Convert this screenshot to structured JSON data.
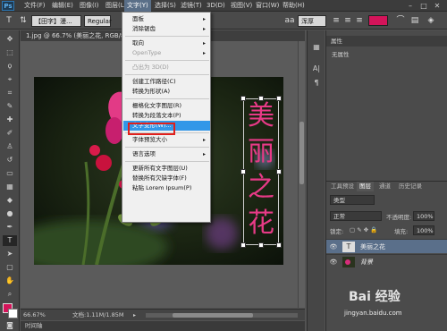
{
  "app": {
    "logo": "Ps"
  },
  "menubar": {
    "items": [
      "文件(F)",
      "编辑(E)",
      "图像(I)",
      "图层(L)",
      "文字(Y)",
      "选择(S)",
      "滤镜(T)",
      "3D(D)",
      "视图(V)",
      "窗口(W)",
      "帮助(H)"
    ],
    "active_index": 4,
    "window_buttons": [
      "–",
      "□",
      "✕"
    ]
  },
  "options": {
    "tool_icon": "T",
    "font_family": "【田字】漫...",
    "font_style": "Regular",
    "aa_mode": "浑厚",
    "text_color": "#d4145a"
  },
  "document": {
    "tab_label": "1.jpg @ 66.7% (美丽之花, RGB/8) *",
    "close": "✕",
    "zoom": "66.67%",
    "doc_size": "文档:1.11M/1.85M",
    "timeline": "时间轴",
    "canvas_text": [
      "美",
      "丽",
      "之",
      "花"
    ],
    "canvas_text_color": "#e83a87"
  },
  "dropdown": {
    "items": [
      {
        "label": "面板",
        "arrow": true,
        "disabled": false
      },
      {
        "label": "消除锯齿",
        "arrow": true,
        "disabled": false
      },
      {
        "sep": true
      },
      {
        "label": "取向",
        "arrow": true,
        "disabled": false
      },
      {
        "label": "OpenType",
        "arrow": true,
        "disabled": true
      },
      {
        "sep": true
      },
      {
        "label": "凸出为 3D(D)",
        "disabled": true
      },
      {
        "sep": true
      },
      {
        "label": "创建工作路径(C)",
        "disabled": false
      },
      {
        "label": "转换为形状(A)",
        "disabled": false
      },
      {
        "sep": true
      },
      {
        "label": "栅格化文字图层(R)",
        "disabled": false
      },
      {
        "label": "转换为段落文本(P)",
        "disabled": false
      },
      {
        "label": "文字变形(W)...",
        "disabled": false,
        "highlight": true
      },
      {
        "sep": true
      },
      {
        "label": "字体预览大小",
        "arrow": true,
        "disabled": false
      },
      {
        "sep": true
      },
      {
        "label": "语言选项",
        "arrow": true,
        "disabled": false
      },
      {
        "sep": true
      },
      {
        "label": "更新所有文字图层(U)",
        "disabled": false
      },
      {
        "label": "替换所有欠缺字体(F)",
        "disabled": false
      },
      {
        "label": "粘贴 Lorem Ipsum(P)",
        "disabled": false
      }
    ]
  },
  "properties": {
    "title": "属性",
    "empty_text": "无属性"
  },
  "layers": {
    "tabs": [
      "工具预设",
      "图层",
      "通道",
      "历史记录"
    ],
    "blend_mode": "正常",
    "opacity_label": "不透明度:",
    "opacity_value": "100%",
    "lock_label": "锁定:",
    "fill_label": "填充:",
    "fill_value": "100%",
    "filter_label": "类型",
    "rows": [
      {
        "name": "美丽之花",
        "type_icon": "T",
        "selected": true
      },
      {
        "name": "背景",
        "selected": false
      }
    ]
  },
  "watermark": {
    "text": "Bai 经验",
    "sub": "jingyan.baidu.com"
  }
}
